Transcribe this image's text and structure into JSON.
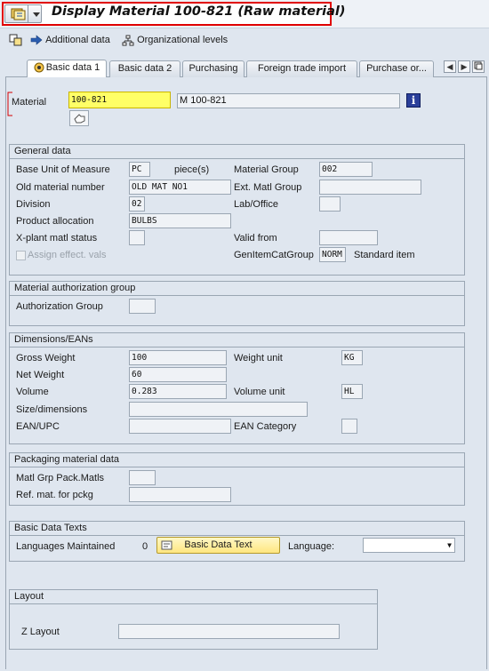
{
  "window": {
    "title": "Display Material 100-821 (Raw material)"
  },
  "toolbar": {
    "additional_data": "Additional data",
    "organizational_levels": "Organizational levels"
  },
  "tabs": [
    {
      "label": "Basic data 1",
      "active": true
    },
    {
      "label": "Basic data 2",
      "active": false
    },
    {
      "label": "Purchasing",
      "active": false
    },
    {
      "label": "Foreign trade import",
      "active": false
    },
    {
      "label": "Purchase or...",
      "active": false
    }
  ],
  "header": {
    "material_label": "Material",
    "material_value": "100-821",
    "material_description": "M 100-821"
  },
  "general_data": {
    "title": "General data",
    "base_uom_label": "Base Unit of Measure",
    "base_uom_value": "PC",
    "base_uom_text": "piece(s)",
    "material_group_label": "Material Group",
    "material_group_value": "002",
    "old_material_label": "Old material number",
    "old_material_value": "OLD MAT NO1",
    "ext_matl_group_label": "Ext. Matl Group",
    "ext_matl_group_value": "",
    "division_label": "Division",
    "division_value": "02",
    "lab_office_label": "Lab/Office",
    "lab_office_value": "",
    "product_allocation_label": "Product allocation",
    "product_allocation_value": "BULBS",
    "xplant_status_label": "X-plant matl status",
    "xplant_status_value": "",
    "valid_from_label": "Valid from",
    "valid_from_value": "",
    "assign_effect_label": "Assign effect. vals",
    "gen_item_cat_label": "GenItemCatGroup",
    "gen_item_cat_value": "NORM",
    "gen_item_cat_text": "Standard item"
  },
  "auth_group": {
    "title": "Material authorization group",
    "label": "Authorization Group",
    "value": ""
  },
  "dimensions": {
    "title": "Dimensions/EANs",
    "gross_weight_label": "Gross Weight",
    "gross_weight_value": "100",
    "weight_unit_label": "Weight unit",
    "weight_unit_value": "KG",
    "net_weight_label": "Net Weight",
    "net_weight_value": "60",
    "volume_label": "Volume",
    "volume_value": "0.283",
    "volume_unit_label": "Volume unit",
    "volume_unit_value": "HL",
    "size_label": "Size/dimensions",
    "size_value": "",
    "ean_label": "EAN/UPC",
    "ean_value": "",
    "ean_category_label": "EAN Category",
    "ean_category_value": ""
  },
  "packaging": {
    "title": "Packaging material data",
    "matl_grp_label": "Matl Grp Pack.Matls",
    "matl_grp_value": "",
    "ref_mat_label": "Ref. mat. for pckg",
    "ref_mat_value": ""
  },
  "basic_texts": {
    "title": "Basic Data Texts",
    "languages_label": "Languages Maintained",
    "languages_count": "0",
    "button_label": "Basic Data Text",
    "language_label": "Language:",
    "language_value": ""
  },
  "layout": {
    "title": "Layout",
    "z_layout_label": "Z Layout",
    "z_layout_value": ""
  },
  "colors": {
    "title_frame": "#e00000",
    "highlight_field": "#ffff66",
    "background": "#dfe6ef"
  }
}
